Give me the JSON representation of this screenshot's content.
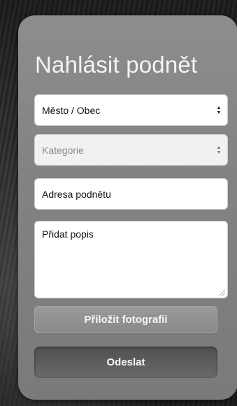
{
  "form": {
    "title": "Nahlásit podnět",
    "city_select": {
      "value": "Město / Obec"
    },
    "category_select": {
      "value": "Kategorie"
    },
    "address_input": {
      "value": "Adresa podnětu"
    },
    "description_textarea": {
      "value": "Přidat popis"
    },
    "attach_photo_label": "Přiložit fotografii",
    "submit_label": "Odeslat"
  },
  "icons": {
    "select_arrows": "updown-arrows-icon",
    "resize_grip": "resize-grip-icon"
  },
  "colors": {
    "card": "#858585",
    "title": "#f4f4f4",
    "submit_button": "#5a5a5a"
  }
}
